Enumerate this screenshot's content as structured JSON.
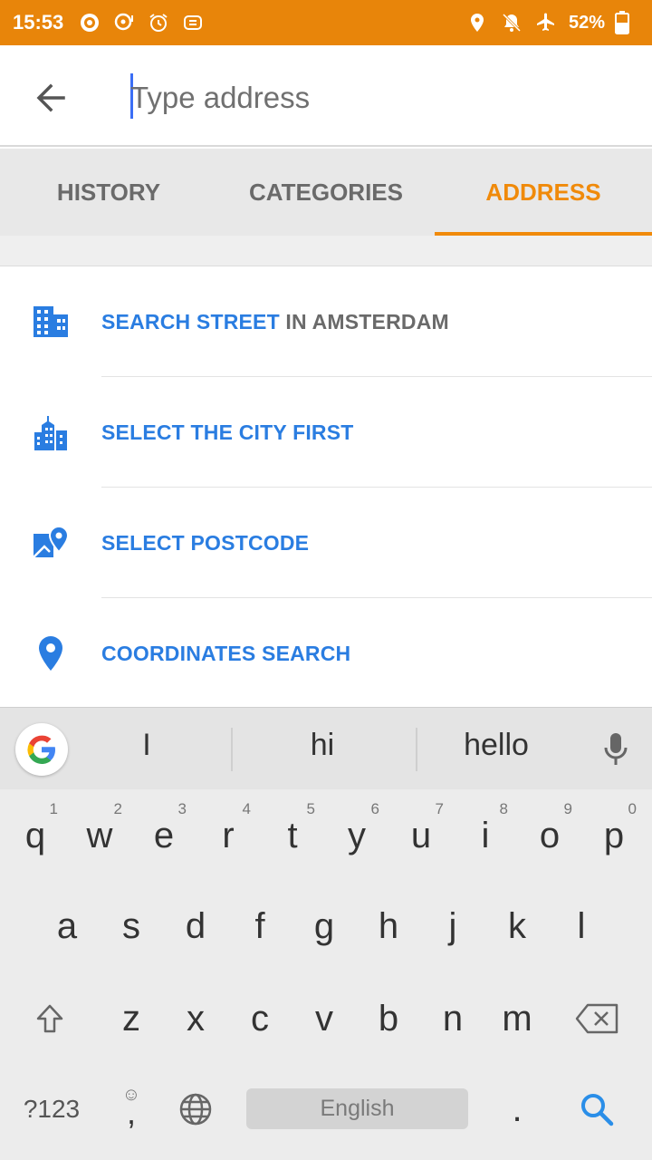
{
  "status_bar": {
    "time": "15:53",
    "battery": "52%",
    "icons_left": [
      "target-icon",
      "chat-icon",
      "alarm-icon",
      "cast-icon"
    ],
    "icons_right": [
      "location-icon",
      "notifications-off-icon",
      "airplane-icon",
      "battery-icon"
    ]
  },
  "search": {
    "placeholder": "Type address",
    "value": ""
  },
  "tabs": [
    {
      "label": "HISTORY",
      "active": false
    },
    {
      "label": "CATEGORIES",
      "active": false
    },
    {
      "label": "ADDRESS",
      "active": true
    }
  ],
  "list": {
    "items": [
      {
        "icon": "building-icon",
        "label": "SEARCH STREET",
        "suffix": " IN AMSTERDAM"
      },
      {
        "icon": "city-icon",
        "label": "SELECT THE CITY FIRST",
        "suffix": ""
      },
      {
        "icon": "map-pin-icon",
        "label": "SELECT POSTCODE",
        "suffix": ""
      },
      {
        "icon": "location-pin-icon",
        "label": "COORDINATES SEARCH",
        "suffix": ""
      }
    ]
  },
  "keyboard": {
    "suggestions": [
      "I",
      "hi",
      "hello"
    ],
    "row1": [
      "q",
      "w",
      "e",
      "r",
      "t",
      "y",
      "u",
      "i",
      "o",
      "p"
    ],
    "row1_hints": [
      "1",
      "2",
      "3",
      "4",
      "5",
      "6",
      "7",
      "8",
      "9",
      "0"
    ],
    "row2": [
      "a",
      "s",
      "d",
      "f",
      "g",
      "h",
      "j",
      "k",
      "l"
    ],
    "row3": [
      "z",
      "x",
      "c",
      "v",
      "b",
      "n",
      "m"
    ],
    "symbols_label": "?123",
    "comma": ",",
    "period": ".",
    "space_label": "English"
  },
  "colors": {
    "accent": "#F08A0A",
    "status_bar": "#E8850A",
    "link": "#2a7de1"
  }
}
